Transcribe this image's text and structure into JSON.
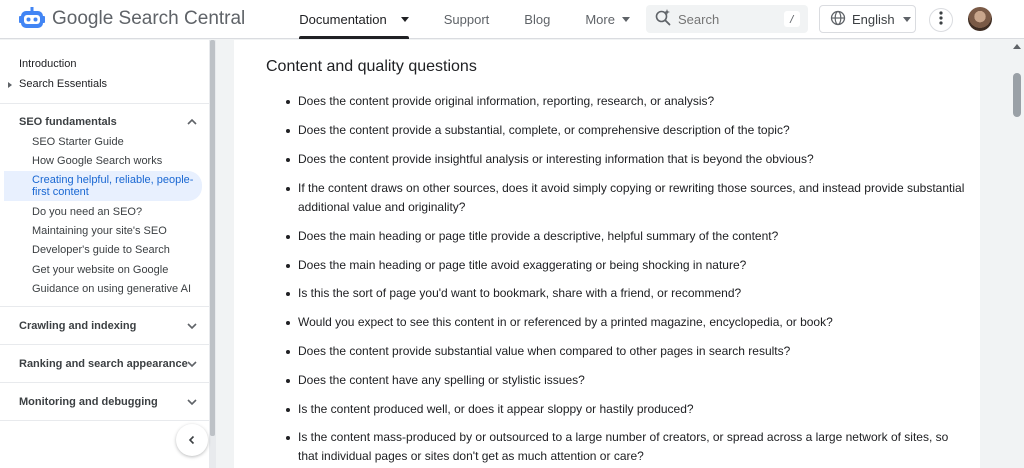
{
  "header": {
    "logo_text": "Google Search Central",
    "nav": [
      {
        "label": "Documentation",
        "active": true,
        "has_menu": true
      },
      {
        "label": "Support",
        "active": false,
        "has_menu": false
      },
      {
        "label": "Blog",
        "active": false,
        "has_menu": false
      },
      {
        "label": "More",
        "active": false,
        "has_menu": true
      }
    ],
    "search": {
      "placeholder": "Search",
      "shortcut": "/"
    },
    "language": "English",
    "icons": {
      "logo": "search-central-robot-icon",
      "search": "search-sparkle-icon",
      "globe": "globe-icon",
      "more": "vertical-dots-icon"
    }
  },
  "sidebar": {
    "top_items": [
      "Introduction",
      "Search Essentials"
    ],
    "sections": [
      {
        "label": "SEO fundamentals",
        "expanded": true,
        "items": [
          {
            "label": "SEO Starter Guide",
            "active": false
          },
          {
            "label": "How Google Search works",
            "active": false
          },
          {
            "label": "Creating helpful, reliable, people-",
            "label_line2": "first content",
            "active": true
          },
          {
            "label": "Do you need an SEO?",
            "active": false
          },
          {
            "label": "Maintaining your site's SEO",
            "active": false
          },
          {
            "label": "Developer's guide to Search",
            "active": false
          },
          {
            "label": "Get your website on Google",
            "active": false
          },
          {
            "label": "Guidance on using generative AI",
            "active": false
          }
        ]
      },
      {
        "label": "Crawling and indexing",
        "expanded": false
      },
      {
        "label": "Ranking and search appearance",
        "expanded": false
      },
      {
        "label": "Monitoring and debugging",
        "expanded": false
      }
    ],
    "collapse_icon": "chevron-left-icon"
  },
  "main": {
    "heading": "Content and quality questions",
    "questions": [
      "Does the content provide original information, reporting, research, or analysis?",
      "Does the content provide a substantial, complete, or comprehensive description of the topic?",
      "Does the content provide insightful analysis or interesting information that is beyond the obvious?",
      "If the content draws on other sources, does it avoid simply copying or rewriting those sources, and instead provide substantial additional value and originality?",
      "Does the main heading or page title provide a descriptive, helpful summary of the content?",
      "Does the main heading or page title avoid exaggerating or being shocking in nature?",
      "Is this the sort of page you'd want to bookmark, share with a friend, or recommend?",
      "Would you expect to see this content in or referenced by a printed magazine, encyclopedia, or book?",
      "Does the content provide substantial value when compared to other pages in search results?",
      "Does the content have any spelling or stylistic issues?",
      "Is the content produced well, or does it appear sloppy or hastily produced?",
      "Is the content mass-produced by or outsourced to a large number of creators, or spread across a large network of sites, so that individual pages or sites don't get as much attention or care?"
    ]
  },
  "colors": {
    "accent": "#1967d2",
    "active_bg": "#e8f0fe",
    "text": "#202124",
    "muted": "#5f6368",
    "page_bg": "#f1f3f4"
  }
}
